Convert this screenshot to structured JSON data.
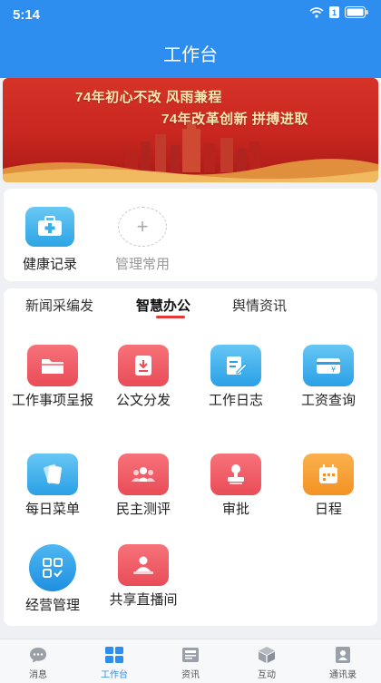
{
  "status_bar": {
    "time": "5:14",
    "battery": "1"
  },
  "header": {
    "title": "工作台"
  },
  "banner": {
    "line1": "74年初心不改 风雨兼程",
    "line2": "74年改革创新 拼搏进取"
  },
  "common": {
    "items": [
      {
        "label": "健康记录",
        "icon": "first-aid-kit-icon"
      },
      {
        "label": "管理常用",
        "icon": "plus-icon"
      }
    ]
  },
  "tabs": {
    "items": [
      {
        "label": "新闻采编发"
      },
      {
        "label": "智慧办公"
      },
      {
        "label": "舆情资讯"
      }
    ],
    "active_index": 1
  },
  "apps": [
    {
      "label": "工作事项呈报",
      "icon": "folder-icon"
    },
    {
      "label": "公文分发",
      "icon": "document-download-icon"
    },
    {
      "label": "工作日志",
      "icon": "edit-log-icon"
    },
    {
      "label": "工资查询",
      "icon": "salary-card-icon"
    },
    {
      "label": "每日菜单",
      "icon": "menu-cards-icon"
    },
    {
      "label": "民主测评",
      "icon": "people-group-icon"
    },
    {
      "label": "审批",
      "icon": "stamp-icon"
    },
    {
      "label": "日程",
      "icon": "calendar-icon"
    },
    {
      "label": "经营管理",
      "icon": "grid-check-icon"
    },
    {
      "label": "共享直播间",
      "icon": "presenter-icon"
    }
  ],
  "bottom_nav": {
    "items": [
      {
        "label": "消息",
        "icon": "chat-icon"
      },
      {
        "label": "工作台",
        "icon": "workbench-grid-icon"
      },
      {
        "label": "资讯",
        "icon": "news-icon"
      },
      {
        "label": "互动",
        "icon": "cube-icon"
      },
      {
        "label": "通讯录",
        "icon": "contacts-icon"
      }
    ],
    "active_index": 1
  },
  "colors": {
    "primary": "#2d8ef0",
    "accent_red": "#e53935",
    "banner_red": "#c8261f"
  }
}
